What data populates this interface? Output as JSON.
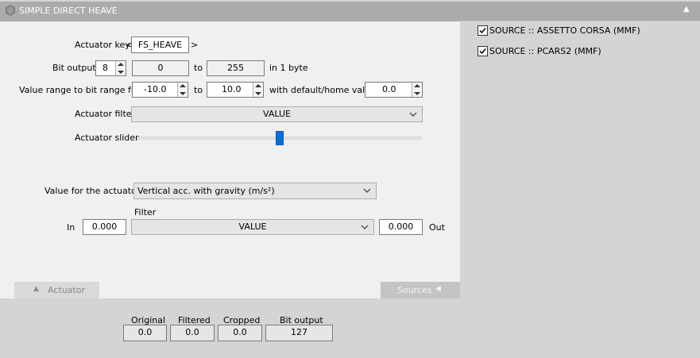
{
  "window": {
    "title": "SIMPLE DIRECT HEAVE",
    "collapse_glyph": "▲"
  },
  "actuator_key": {
    "label": "Actuator key",
    "left_arrow": "<",
    "value": "FS_HEAVE",
    "right_arrow": ">"
  },
  "bit_output": {
    "label": "Bit output",
    "bits": "8",
    "min": "0",
    "to_label": "to",
    "max": "255",
    "suffix": "in 1 byte"
  },
  "value_range": {
    "label": "Value range to bit range from",
    "from": "-10.0",
    "to_label": "to",
    "to": "10.0",
    "default_label": "with default/home value",
    "default": "0.0"
  },
  "actuator_filter": {
    "label": "Actuator filter",
    "selected": "VALUE"
  },
  "actuator_slider": {
    "label": "Actuator slider",
    "position": 0.5
  },
  "value_for_actuator": {
    "label": "Value for the actuator",
    "selected": "Vertical acc. with gravity (m/s²)"
  },
  "filter_row": {
    "header": "Filter",
    "in_label": "In",
    "in_value": "0.000",
    "selected": "VALUE",
    "out_value": "0.000",
    "out_label": "Out"
  },
  "tabs": {
    "actuator": {
      "icon": "▲",
      "label": "Actuator"
    },
    "sources": {
      "label": "Sources",
      "icon": "◀"
    }
  },
  "readouts": {
    "original": {
      "label": "Original",
      "value": "0.0"
    },
    "filtered": {
      "label": "Filtered",
      "value": "0.0"
    },
    "cropped": {
      "label": "Cropped",
      "value": "0.0"
    },
    "bit_output": {
      "label": "Bit output",
      "value": "127"
    }
  },
  "sources": [
    {
      "label": "SOURCE :: ASSETTO CORSA (MMF)",
      "checked": true
    },
    {
      "label": "SOURCE :: PCARS2 (MMF)",
      "checked": true
    }
  ],
  "colors": {
    "slider_thumb": "#0b6ed6",
    "panel_bg": "#f0f0f0",
    "title_bg": "#ababab"
  }
}
